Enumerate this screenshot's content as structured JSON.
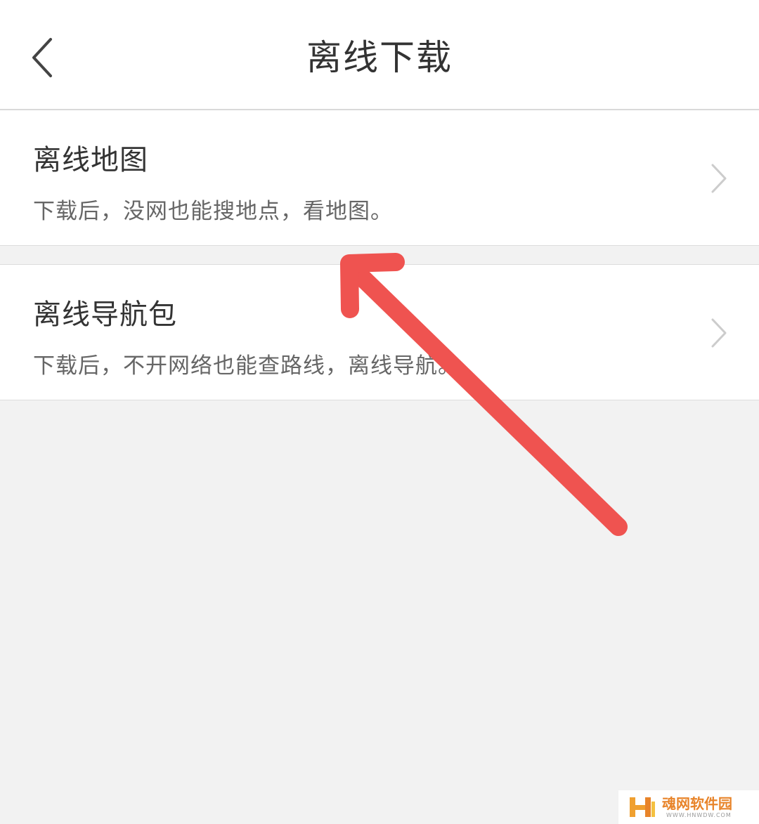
{
  "header": {
    "title": "离线下载",
    "back_icon": "chevron-left-icon"
  },
  "items": [
    {
      "title": "离线地图",
      "subtitle": "下载后，没网也能搜地点，看地图。",
      "icon": "chevron-right-icon"
    },
    {
      "title": "离线导航包",
      "subtitle": "下载后，不开网络也能查路线，离线导航。",
      "icon": "chevron-right-icon"
    }
  ],
  "annotation": {
    "type": "arrow",
    "color": "#ef5350"
  },
  "watermark": {
    "name": "魂网软件园",
    "url": "WWW.HNWDW.COM",
    "color": "#e8842a"
  },
  "colors": {
    "background": "#f2f2f2",
    "surface": "#ffffff",
    "text_primary": "#333333",
    "text_secondary": "#666666",
    "chevron": "#cccccc"
  }
}
